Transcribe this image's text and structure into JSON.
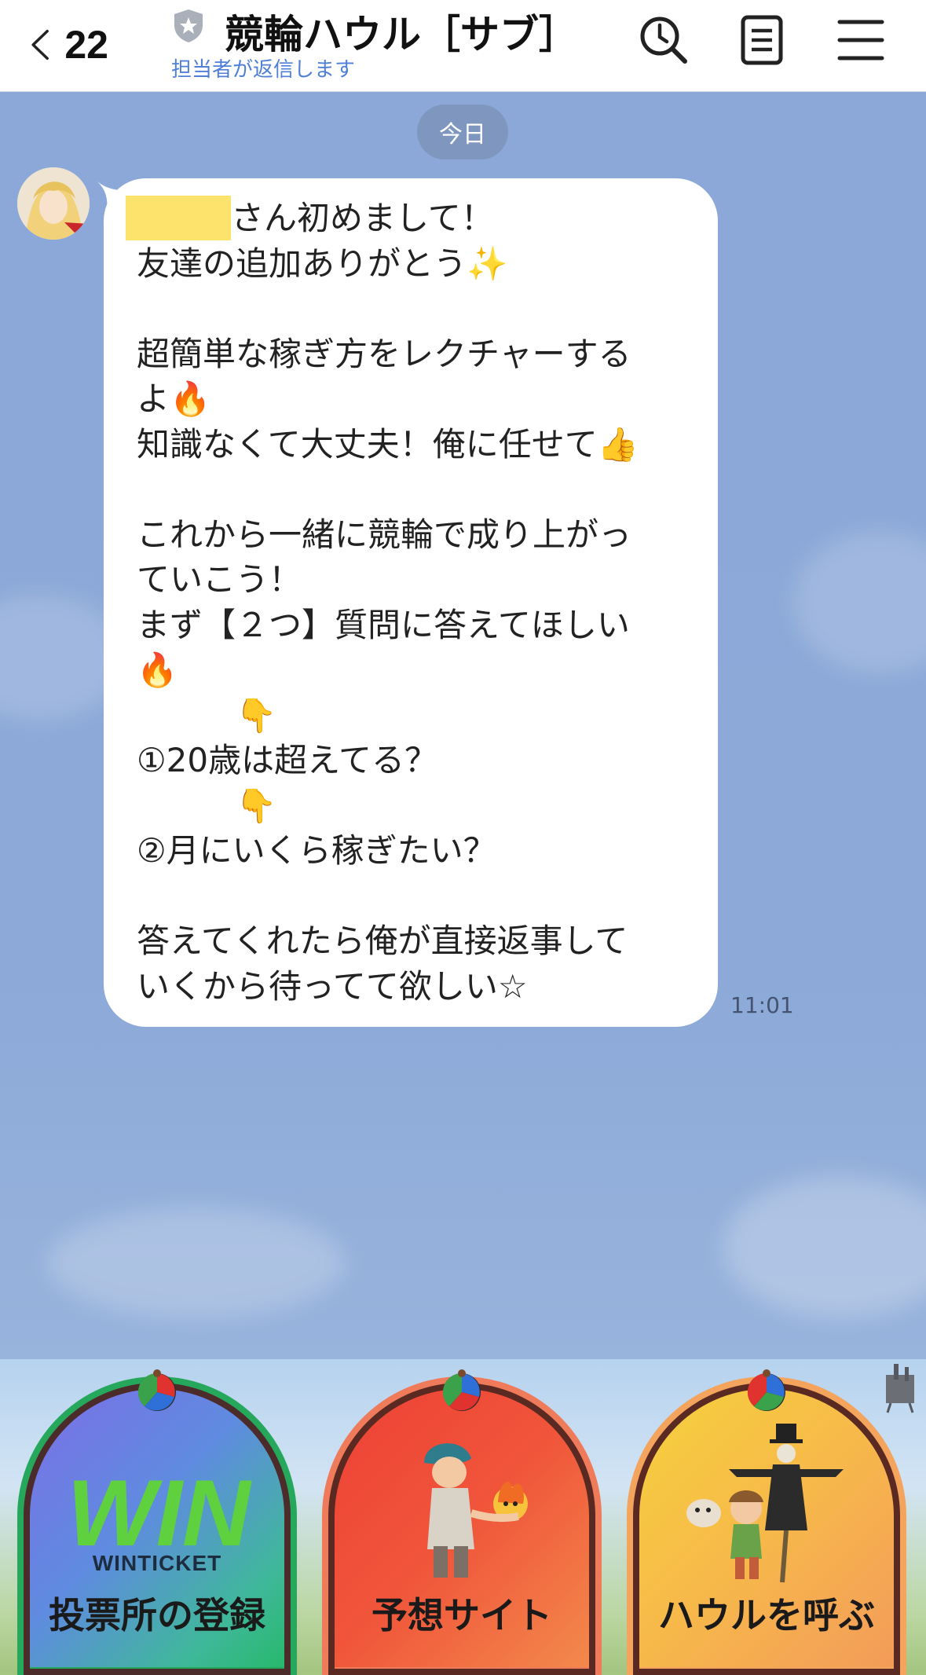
{
  "header": {
    "back_count": "22",
    "title": "競輪ハウル［サブ］",
    "subtitle": "担当者が返信します",
    "icons": [
      "chevron-left-icon",
      "shield-icon",
      "clock-search-icon",
      "note-icon",
      "menu-icon"
    ]
  },
  "chat": {
    "date_label": "今日",
    "message": {
      "lines": [
        "さん初めまして！",
        "友達の追加ありがとう✨",
        "",
        "超簡単な稼ぎ方をレクチャーする",
        "よ🔥",
        "知識なくて大丈夫！俺に任せて👍",
        "",
        "これから一緒に競輪で成り上がっ",
        "ていこう！",
        "まず【２つ】質問に答えてほしい",
        "🔥",
        "　　　👇",
        "①20歳は超えてる？",
        "　　　👇",
        "②月にいくら稼ぎたい？",
        "",
        "答えてくれたら俺が直接返事して",
        "いくから待ってて欲しい☆"
      ],
      "time": "11:01"
    }
  },
  "rich_menu": {
    "items": [
      {
        "label": "投票所の登録",
        "logo_text": "WIN",
        "logo_sub": "WINTICKET"
      },
      {
        "label": "予想サイト"
      },
      {
        "label": "ハウルを呼ぶ"
      }
    ]
  },
  "colors": {
    "chat_bg": "#8eaad6",
    "link_blue": "#4f7fd6",
    "name_highlight": "#fde36b",
    "arch_border": "#5b2f27"
  }
}
